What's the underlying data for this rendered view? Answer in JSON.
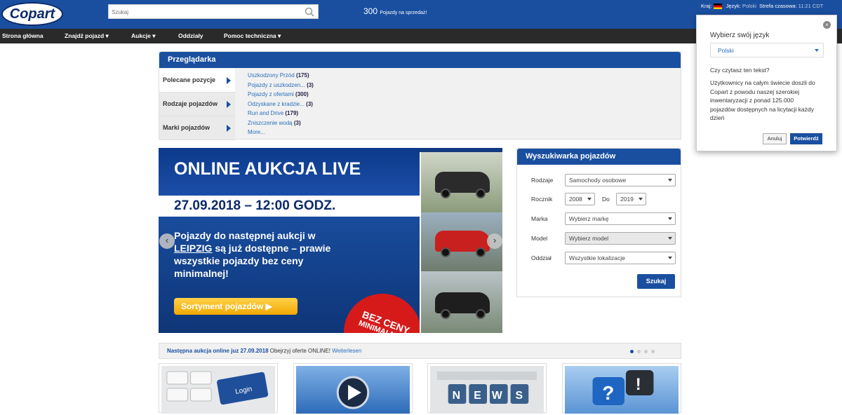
{
  "header": {
    "logo_text": "Copart",
    "search_placeholder": "Szukaj",
    "vehicle_count": "300",
    "vehicle_count_label": "Pojazdy na sprzedaż!",
    "country_label": "Kraj:",
    "language_label": "Język:",
    "language_value": "Polski",
    "timezone_label": "Strefa czasowa:",
    "timezone_value": "11:21 CDT"
  },
  "nav": {
    "items": [
      "Strona główna",
      "Znajdź pojazd ▾",
      "Aukcje ▾",
      "Oddziały",
      "Pomoc techniczna ▾"
    ]
  },
  "browser": {
    "title": "Przeglądarka",
    "categories": [
      "Polecane pozycje",
      "Rodzaje pojazdów",
      "Marki pojazdów"
    ],
    "links": [
      {
        "label": "Uszkodzony Przód",
        "count": "(175)"
      },
      {
        "label": "Pojazdy z uszkodzen...",
        "count": "(3)"
      },
      {
        "label": "Pojazdy z ofertami",
        "count": "(300)"
      },
      {
        "label": "Odzyskane z kradzie...",
        "count": "(3)"
      },
      {
        "label": "Run and Drive",
        "count": "(179)"
      },
      {
        "label": "Zniszczenie wodą",
        "count": "(3)"
      },
      {
        "label": "More...",
        "count": ""
      }
    ]
  },
  "banner": {
    "headline": "ONLINE AUKCJA LIVE",
    "date": "27.09.2018 – 12:00 GODZ.",
    "text_before": "Pojazdy do następnej aukcji w",
    "city": "LEIPZIG",
    "text_after": "są już dostępne – prawie wszystkie pojazdy bez ceny minimalnej!",
    "button": "Sortyment pojazdów ▶",
    "seal_line1": "BEZ CENY",
    "seal_line2": "MINIMALNEJ!"
  },
  "vehicle_search": {
    "title": "Wyszukiwarka pojazdów",
    "type_label": "Rodzaje",
    "type_value": "Samochody osobowe",
    "year_label": "Rocznik",
    "year_from": "2008",
    "year_to_label": "Do",
    "year_to": "2019",
    "make_label": "Marka",
    "make_value": "Wybierz markę",
    "model_label": "Model",
    "model_value": "Wybierz model",
    "branch_label": "Oddział",
    "branch_value": "Wszystkie lokalizacje",
    "submit": "Szukaj"
  },
  "next_auction": {
    "bold": "Następna aukcja online juz 27.09.2018",
    "text": "Obejrzyj oferte ONLINE!",
    "link": "Weiterlesen"
  },
  "tiles": [
    "login-keyboard",
    "play-video",
    "news",
    "help-question"
  ],
  "language_popup": {
    "title": "Wybierz swój język",
    "selected": "Polski",
    "question": "Czy czytasz ten tekst?",
    "body": "Użytkownicy na całym świecie doszli do Copart z powodu naszej szerokiej inwentaryzacji z ponad 125.000 pojazdów dostępnych na licytacji każdy dzień",
    "cancel": "Anuluj",
    "confirm": "Potwierdź"
  },
  "colors": {
    "brand_blue": "#1a4fa0",
    "nav_dark": "#2a2a2a",
    "link_blue": "#2a6ebb"
  }
}
